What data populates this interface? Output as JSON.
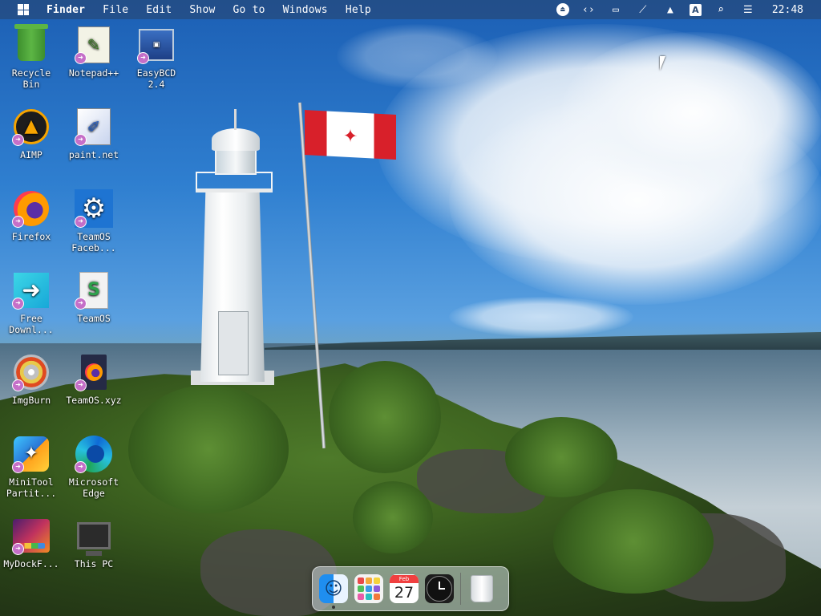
{
  "menubar": {
    "app_name": "Finder",
    "menus": [
      "File",
      "Edit",
      "Show",
      "Go to",
      "Windows",
      "Help"
    ],
    "tray": {
      "eject": "eject-icon",
      "code": "code-icon",
      "display": "display-icon",
      "network": "network-off-icon",
      "upload": "upload-icon",
      "input_source_label": "A",
      "search": "search-icon",
      "control_center": "toggle-icon"
    },
    "clock": "22:48"
  },
  "desktop_icons": [
    {
      "label": "Recycle\nBin",
      "icon": "recycle-bin-icon"
    },
    {
      "label": "Notepad++",
      "icon": "notepad-plus-plus-icon"
    },
    {
      "label": "EasyBCD\n2.4",
      "icon": "easybcd-icon"
    },
    {
      "label": "AIMP",
      "icon": "aimp-icon"
    },
    {
      "label": "paint.net",
      "icon": "paint-net-icon"
    },
    {
      "label": "Firefox",
      "icon": "firefox-icon"
    },
    {
      "label": "TeamOS\nFaceb...",
      "icon": "gear-icon"
    },
    {
      "label": "Free\nDownl...",
      "icon": "free-download-manager-icon"
    },
    {
      "label": "TeamOS",
      "icon": "teamos-icon"
    },
    {
      "label": "ImgBurn",
      "icon": "imgburn-icon"
    },
    {
      "label": "TeamOS.xyz",
      "icon": "teamos-xyz-icon"
    },
    {
      "label": "MiniTool\nPartit...",
      "icon": "minitool-icon"
    },
    {
      "label": "Microsoft\nEdge",
      "icon": "edge-icon"
    },
    {
      "label": "MyDockF...",
      "icon": "mydock-icon"
    },
    {
      "label": "This PC",
      "icon": "this-pc-icon"
    }
  ],
  "dock": {
    "calendar_month": "Feb",
    "calendar_day": "27",
    "items": [
      "finder-icon",
      "launchpad-icon",
      "calendar-icon",
      "clock-icon",
      "trash-icon"
    ]
  },
  "colors": {
    "menubar": "#284268",
    "shortcut_badge": "#c56fc8",
    "flag_red": "#d8202a"
  }
}
